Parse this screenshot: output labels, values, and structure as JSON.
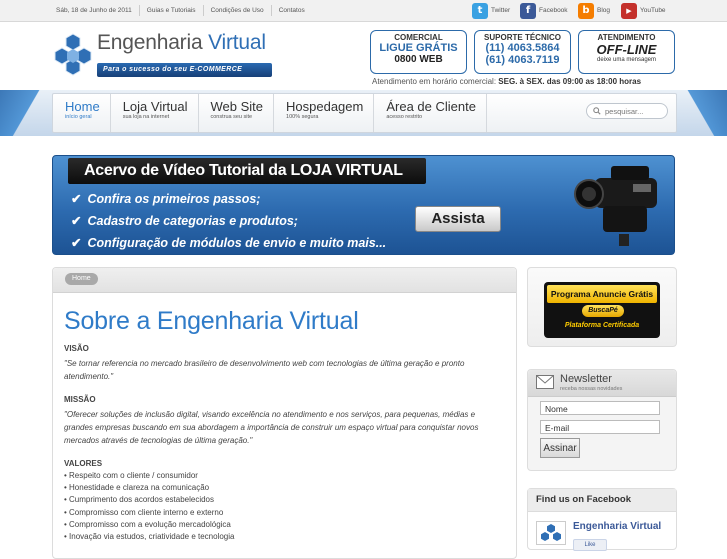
{
  "topbar": {
    "date": "Sáb, 18 de Junho de 2011",
    "links": [
      "Guias e Tutoriais",
      "Condições de Uso",
      "Contatos"
    ],
    "social": [
      {
        "label": "Twitter",
        "icon": "twitter-icon",
        "color": "#3aa1e2"
      },
      {
        "label": "Facebook",
        "icon": "facebook-icon",
        "color": "#3b5998"
      },
      {
        "label": "Blog",
        "icon": "blog-icon",
        "color": "#f57d00"
      },
      {
        "label": "YouTube",
        "icon": "youtube-icon",
        "color": "#c4302b"
      }
    ]
  },
  "header": {
    "brand_part1": "Engenharia",
    "brand_part2": "Virtual",
    "tagline": "Para o sucesso do seu E-COMMERCE",
    "comercial": {
      "title": "COMERCIAL",
      "line1": "LIGUE GRÁTIS",
      "line2": "0800 WEB"
    },
    "suporte": {
      "title": "SUPORTE TÉCNICO",
      "line1": "(11) 4063.5864",
      "line2": "(61) 4063.7119"
    },
    "atendimento": {
      "title": "ATENDIMENTO",
      "status": "OFF-LINE",
      "note": "deixe uma mensagem"
    },
    "hours_prefix": "Atendimento em horário comercial:",
    "hours_value": "SEG. à SEX. das 09:00 as 18:00 horas"
  },
  "nav": {
    "items": [
      {
        "label": "Home",
        "sub": "início geral"
      },
      {
        "label": "Loja Virtual",
        "sub": "sua loja na internet"
      },
      {
        "label": "Web Site",
        "sub": "construa seu site"
      },
      {
        "label": "Hospedagem",
        "sub": "100% segura"
      },
      {
        "label": "Área de Cliente",
        "sub": "acesso restrito"
      }
    ],
    "search_placeholder": "pesquisar..."
  },
  "banner": {
    "title": "Acervo de Vídeo Tutorial da LOJA VIRTUAL",
    "bullets": [
      "Confira os primeiros passos;",
      "Cadastro de categorias e produtos;",
      "Configuração de módulos de envio e muito mais..."
    ],
    "button": "Assista",
    "accent": "#2d6bb0"
  },
  "main": {
    "breadcrumb": "Home",
    "title": "Sobre a Engenharia Virtual",
    "visao_label": "VISÃO",
    "visao_text": "\"Se tornar referencia no mercado brasileiro de desenvolvimento web com tecnologias de última geração e pronto atendimento.\"",
    "missao_label": "MISSÃO",
    "missao_text": "\"Oferecer soluções de inclusão digital, visando excelência no atendimento e nos serviços, para pequenas, médias e grandes empresas buscando em sua abordagem a importância de construir um espaço virtual para conquistar novos mercados através de tecnologias de última geração.\"",
    "valores_label": "VALORES",
    "valores": [
      "• Respeito com o cliente / consumidor",
      "• Honestidade e clareza na comunicação",
      "• Cumprimento dos acordos estabelecidos",
      "• Compromisso com cliente interno e externo",
      "• Compromisso com a evolução mercadológica",
      "• Inovação via estudos, criatividade e tecnologia"
    ]
  },
  "sidebar": {
    "badge_top": "Programa Anuncie Grátis",
    "badge_logo": "BuscaPé",
    "badge_bottom": "Plataforma Certificada",
    "newsletter_title": "Newsletter",
    "newsletter_sub": "receba nossas novidades",
    "name_value": "Nome",
    "email_value": "E-mail",
    "subscribe": "Assinar",
    "facebook_heading": "Find us on Facebook",
    "facebook_page": "Engenharia Virtual",
    "facebook_like": "Like"
  }
}
